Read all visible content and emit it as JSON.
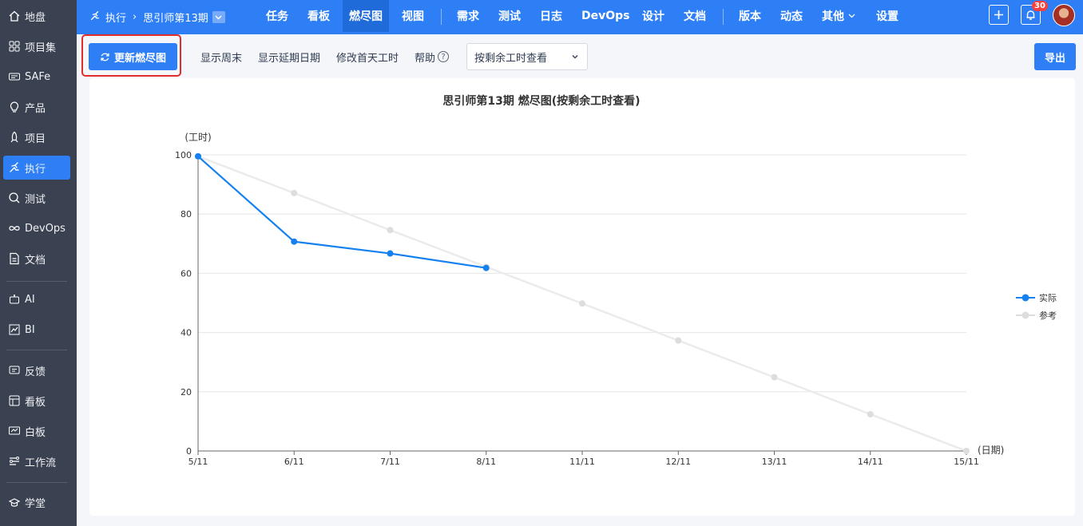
{
  "sidebar": {
    "items": [
      {
        "label": "地盘",
        "icon": "home-icon"
      },
      {
        "label": "项目集",
        "icon": "grid-icon"
      },
      {
        "label": "SAFe",
        "icon": "safe-icon"
      },
      {
        "label": "产品",
        "icon": "bulb-icon"
      },
      {
        "label": "项目",
        "icon": "rocket-icon"
      },
      {
        "label": "执行",
        "icon": "run-icon"
      },
      {
        "label": "测试",
        "icon": "search-icon"
      },
      {
        "label": "DevOps",
        "icon": "infinity-icon"
      },
      {
        "label": "文档",
        "icon": "document-icon"
      },
      {
        "label": "AI",
        "icon": "robot-icon"
      },
      {
        "label": "BI",
        "icon": "chart-icon"
      },
      {
        "label": "反馈",
        "icon": "feedback-icon"
      },
      {
        "label": "看板",
        "icon": "kanban-icon"
      },
      {
        "label": "白板",
        "icon": "whiteboard-icon"
      },
      {
        "label": "工作流",
        "icon": "workflow-icon"
      },
      {
        "label": "学堂",
        "icon": "school-icon"
      }
    ]
  },
  "header": {
    "breadcrumb_root": "执行",
    "breadcrumb_current": "思引师第13期",
    "nav": [
      "任务",
      "看板",
      "燃尽图",
      "视图",
      "需求",
      "测试",
      "日志",
      "DevOps",
      "设计",
      "文档",
      "版本",
      "动态",
      "其他",
      "设置"
    ],
    "active_nav": "燃尽图",
    "notification_count": "30"
  },
  "toolbar": {
    "update_button": "更新燃尽图",
    "show_weekend": "显示周末",
    "show_delay": "显示延期日期",
    "edit_first_day": "修改首天工时",
    "help": "帮助",
    "view_select": "按剩余工时查看",
    "export_button": "导出"
  },
  "chart_data": {
    "type": "line",
    "title": "思引师第13期 燃尽图(按剩余工时查看)",
    "ylabel": "(工时)",
    "xlabel": "(日期)",
    "categories": [
      "5/11",
      "6/11",
      "7/11",
      "8/11",
      "11/11",
      "12/11",
      "13/11",
      "14/11",
      "15/11"
    ],
    "ylim": [
      0,
      100
    ],
    "yticks": [
      0,
      20,
      40,
      60,
      80,
      100
    ],
    "grid": true,
    "legend_position": "right",
    "series": [
      {
        "name": "实际",
        "color": "#1580f0",
        "values": [
          99.5,
          70.7,
          66.7,
          61.8,
          null,
          null,
          null,
          null,
          null
        ]
      },
      {
        "name": "参考",
        "color": "#dddddd",
        "values": [
          99.5,
          87.1,
          74.6,
          62.2,
          49.8,
          37.3,
          24.9,
          12.4,
          0
        ]
      }
    ]
  }
}
